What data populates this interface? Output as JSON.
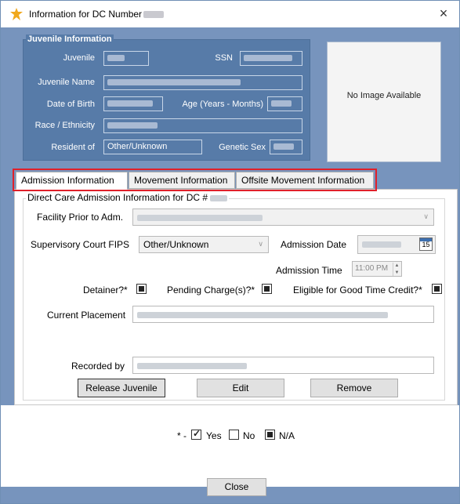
{
  "window": {
    "title": "Information for DC Number",
    "close_glyph": "×"
  },
  "juvenile_info": {
    "legend": "Juvenile Information",
    "labels": {
      "juvenile": "Juvenile",
      "ssn": "SSN",
      "juvenile_name": "Juvenile Name",
      "date_of_birth": "Date of Birth",
      "age": "Age (Years - Months)",
      "race": "Race / Ethnicity",
      "resident_of": "Resident of",
      "genetic_sex": "Genetic Sex"
    },
    "values": {
      "resident_of": "Other/Unknown"
    },
    "image_placeholder": "No Image Available"
  },
  "tabs": [
    {
      "label": "Admission Information",
      "active": true
    },
    {
      "label": "Movement Information",
      "active": false
    },
    {
      "label": "Offsite Movement Information",
      "active": false
    }
  ],
  "admission": {
    "group_legend": "Direct Care Admission Information for DC #",
    "facility_prior_label": "Facility Prior to Adm.",
    "supervisory_court_label": "Supervisory Court FIPS",
    "supervisory_court_value": "Other/Unknown",
    "admission_date_label": "Admission Date",
    "admission_time_label": "Admission Time",
    "admission_time_value": "11:00 PM",
    "calendar_day": "15",
    "detainer_label": "Detainer?*",
    "pending_label": "Pending Charge(s)?*",
    "good_time_label": "Eligible for Good Time Credit?*",
    "current_placement_label": "Current Placement",
    "recorded_by_label": "Recorded by",
    "release_button": "Release Juvenile",
    "edit_button": "Edit",
    "remove_button": "Remove"
  },
  "legend_key": {
    "prefix": "* -",
    "yes": "Yes",
    "no": "No",
    "na": "N/A"
  },
  "footer": {
    "close_button": "Close"
  },
  "colors": {
    "panel": "#577ba8",
    "window_bg": "#7794bd",
    "highlight": "#e0202a"
  }
}
